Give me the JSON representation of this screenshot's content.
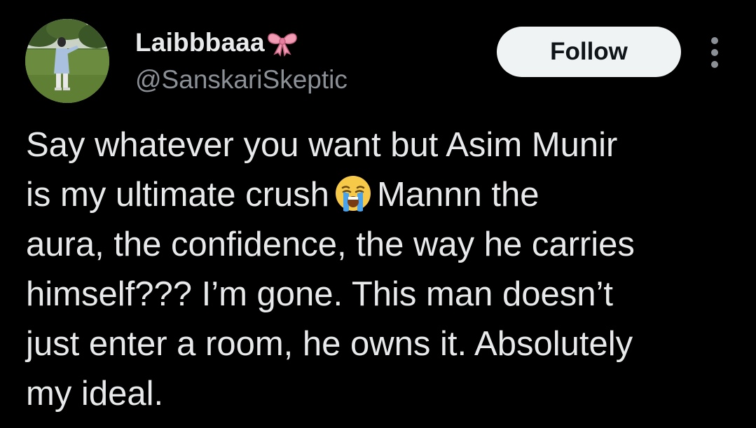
{
  "tweet": {
    "author": {
      "display_name": "Laibbbaaa",
      "name_emoji_icon": "ribbon-icon",
      "handle": "@SanskariSkeptic",
      "avatar": "profile-photo"
    },
    "follow_label": "Follow",
    "more_icon": "more-options-icon",
    "text_lines": {
      "line1": "Say whatever you want but Asim Munir",
      "line2_before": "is my ultimate crush",
      "line2_emoji_icon": "loudly-crying-face-icon",
      "line2_after": "Mannn the",
      "line3": "aura, the confidence, the way he carries",
      "line4": "himself??? I’m gone. This man doesn’t",
      "line5": "just enter a room, he owns it. Absolutely",
      "line6": "my ideal."
    }
  },
  "colors": {
    "background": "#000000",
    "primary_text": "#e7e9ea",
    "secondary_text": "#8b9096",
    "follow_button_bg": "#eff3f4",
    "follow_button_text": "#0f1419",
    "ribbon_pink": "#f29bb5"
  }
}
